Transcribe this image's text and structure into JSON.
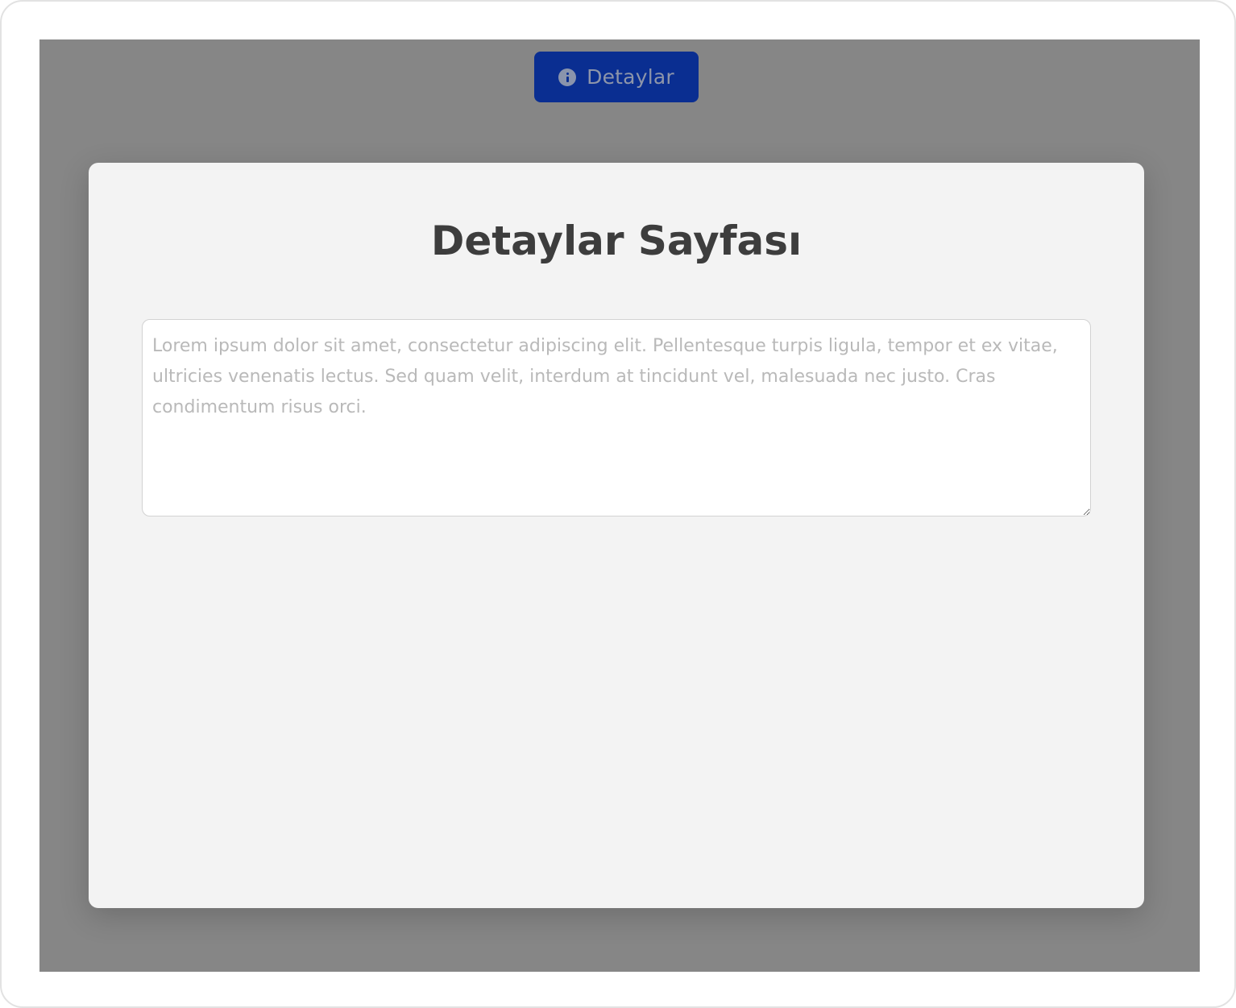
{
  "header": {
    "details_button_label": "Detaylar",
    "details_button_icon": "info-circle-icon"
  },
  "modal": {
    "title": "Detaylar Sayfası",
    "textarea": {
      "value": "",
      "placeholder": "Lorem ipsum dolor sit amet, consectetur adipiscing elit. Pellentesque turpis ligula, tempor et ex vitae, ultricies venenatis lectus. Sed quam velit, interdum at tincidunt vel, malesuada nec justo. Cras condimentum risus orci."
    }
  },
  "colors": {
    "button_background": "#0a2e91",
    "overlay": "#868686",
    "modal_background": "#f3f3f3"
  }
}
